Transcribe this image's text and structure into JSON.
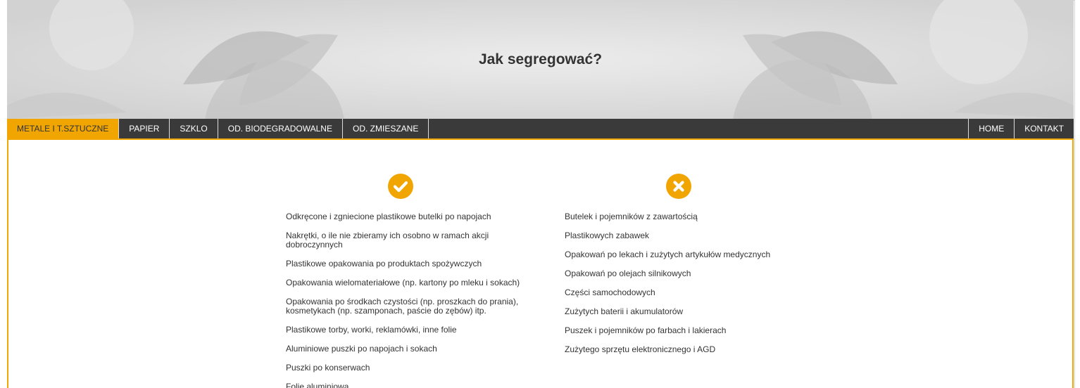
{
  "header": {
    "title": "Jak segregować?"
  },
  "nav": {
    "left": [
      {
        "label": "METALE I T.SZTUCZNE",
        "active": true
      },
      {
        "label": "PAPIER",
        "active": false
      },
      {
        "label": "SZKLO",
        "active": false
      },
      {
        "label": "OD. BIODEGRADOWALNE",
        "active": false
      },
      {
        "label": "OD. ZMIESZANE",
        "active": false
      }
    ],
    "right": [
      {
        "label": "HOME"
      },
      {
        "label": "KONTAKT"
      }
    ]
  },
  "colors": {
    "accent": "#f0a500",
    "nav_bg": "#3a3a3a",
    "text": "#333333"
  },
  "content": {
    "yes": {
      "icon": "checkmark-icon",
      "items": [
        "Odkręcone i zgniecione plastikowe butelki po napojach",
        "Nakrętki, o ile nie zbieramy ich osobno w ramach akcji dobroczynnych",
        "Plastikowe opakowania po produktach spożywczych",
        "Opakowania wielomateriałowe (np. kartony po mleku i sokach)",
        "Opakowania po środkach czystości (np. proszkach do prania), kosmetykach (np. szamponach, paście do zębów) itp.",
        "Plastikowe torby, worki, reklamówki, inne folie",
        "Aluminiowe puszki po napojach i sokach",
        "Puszki po konserwach",
        "Folię aluminiową"
      ]
    },
    "no": {
      "icon": "cross-icon",
      "items": [
        "Butelek i pojemników z zawartością",
        "Plastikowych zabawek",
        "Opakowań po lekach i zużytych artykułów medycznych",
        "Opakowań po olejach silnikowych",
        "Części samochodowych",
        "Zużytych baterii i akumulatorów",
        "Puszek i pojemników po farbach i lakierach",
        "Zużytego sprzętu elektronicznego i AGD"
      ]
    }
  }
}
